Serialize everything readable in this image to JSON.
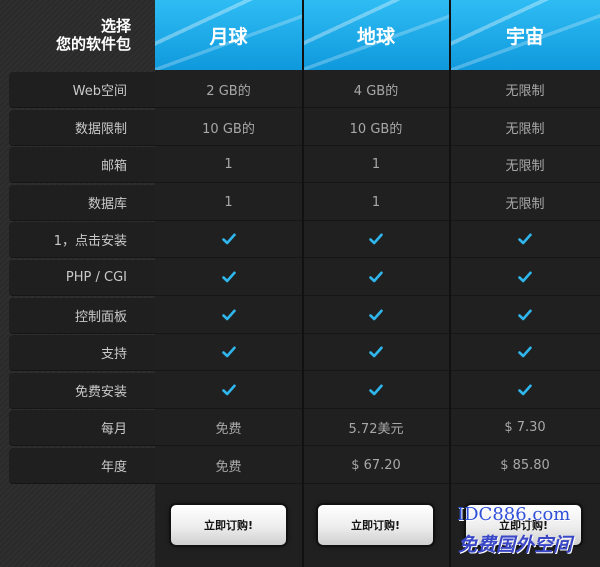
{
  "header": {
    "line1": "选择",
    "line2": "您的软件包"
  },
  "plans": [
    {
      "name": "月球",
      "button_label": "立即订购!"
    },
    {
      "name": "地球",
      "button_label": "立即订购!"
    },
    {
      "name": "宇宙",
      "button_label": "立即订购!"
    }
  ],
  "rows": [
    {
      "label": "Web空间",
      "values": [
        "2 GB的",
        "4 GB的",
        "无限制"
      ]
    },
    {
      "label": "数据限制",
      "values": [
        "10 GB的",
        "10 GB的",
        "无限制"
      ]
    },
    {
      "label": "邮箱",
      "values": [
        "1",
        "1",
        "无限制"
      ]
    },
    {
      "label": "数据库",
      "values": [
        "1",
        "1",
        "无限制"
      ]
    },
    {
      "label": "1，点击安装",
      "values": [
        "check-icon",
        "check-icon",
        "check-icon"
      ]
    },
    {
      "label": "PHP / CGI",
      "values": [
        "check-icon",
        "check-icon",
        "check-icon"
      ]
    },
    {
      "label": "控制面板",
      "values": [
        "check-icon",
        "check-icon",
        "check-icon"
      ]
    },
    {
      "label": "支持",
      "values": [
        "check-icon",
        "check-icon",
        "check-icon"
      ]
    },
    {
      "label": "免费安装",
      "values": [
        "check-icon",
        "check-icon",
        "check-icon"
      ]
    },
    {
      "label": "每月",
      "values": [
        "免费",
        "5.72美元",
        "$ 7.30"
      ]
    },
    {
      "label": "年度",
      "values": [
        "免费",
        "$ 67.20",
        "$ 85.80"
      ]
    }
  ],
  "watermark": {
    "line1": "IDC886.com",
    "line2": "免费国外空间"
  },
  "colors": {
    "header_blue": "#17a7e6",
    "check_blue": "#2fb6ec"
  }
}
